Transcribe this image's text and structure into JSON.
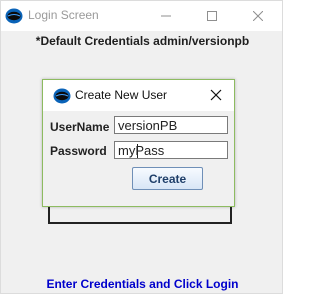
{
  "window": {
    "title": "Login Screen",
    "icon": "app-logo-icon",
    "controls": {
      "minimize": "minimize-icon",
      "maximize": "maximize-icon",
      "close": "close-icon"
    }
  },
  "main": {
    "credentials_hint": "*Default Credentials admin/versionpb",
    "footer_text": "Enter Credentials and Click Login"
  },
  "dialog": {
    "title": "Create New User",
    "icon": "app-logo-icon",
    "close_icon": "close-icon",
    "username_label": "UserName",
    "username_value": "versionPB",
    "password_label": "Password",
    "password_value": "myPass",
    "create_button": "Create"
  },
  "colors": {
    "footer_text": "#0000cc",
    "dialog_border": "#8dbb60",
    "button_border": "#6f8fb7"
  }
}
